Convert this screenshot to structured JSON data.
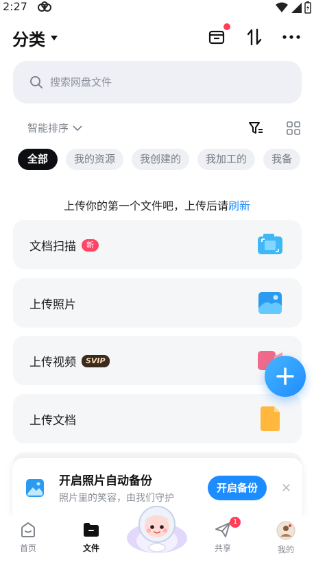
{
  "status_bar": {
    "time": "2:27"
  },
  "header": {
    "title": "分类"
  },
  "search": {
    "placeholder": "搜索网盘文件"
  },
  "sort": {
    "label": "智能排序"
  },
  "chips": [
    "全部",
    "我的资源",
    "我创建的",
    "我加工的",
    "我备"
  ],
  "empty_hint": {
    "text": "上传你的第一个文件吧，上传后请",
    "refresh": "刷新"
  },
  "cards": [
    {
      "label": "文档扫描",
      "badge": "新"
    },
    {
      "label": "上传照片"
    },
    {
      "label": "上传视频",
      "badge": "SVIP"
    },
    {
      "label": "上传文档"
    }
  ],
  "banner": {
    "title": "开启照片自动备份",
    "subtitle": "照片里的笑容，由我们守护",
    "button": "开启备份"
  },
  "tabbar": {
    "items": [
      {
        "label": "首页"
      },
      {
        "label": "文件"
      },
      {
        "label": "共享",
        "badge": "1"
      },
      {
        "label": "我的"
      }
    ]
  },
  "colors": {
    "accent": "#1d8cff",
    "new_badge": "#ff4466",
    "dot": "#ff3e5b"
  }
}
